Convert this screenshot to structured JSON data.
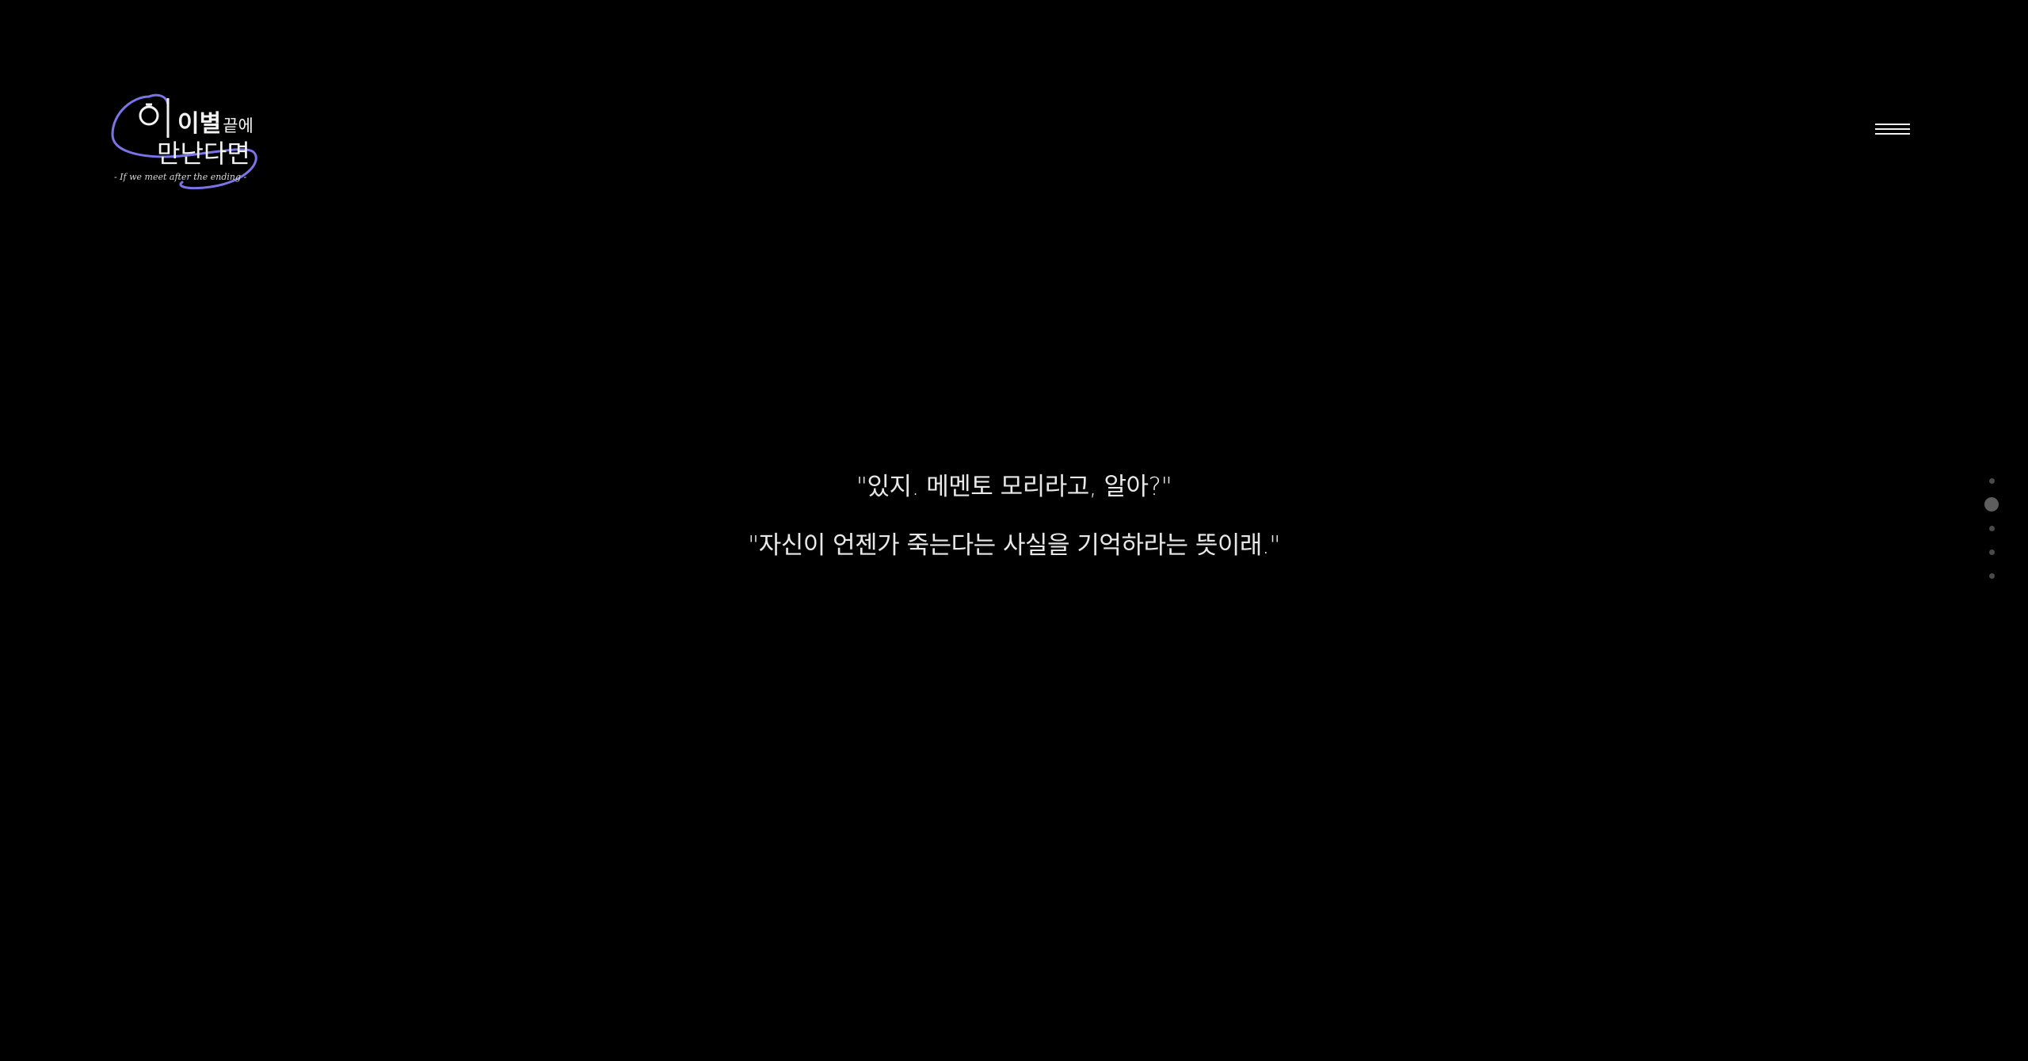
{
  "logo": {
    "title_main": "이별",
    "title_suffix": "끝에",
    "title_second": "만난다면",
    "subtitle": "- If we meet after the ending -",
    "accent_color": "#7b73e8"
  },
  "header": {
    "menu_icon": "hamburger-icon"
  },
  "dialogue": {
    "lines": [
      "\"있지. 메멘토 모리라고, 알아?\"",
      "\"자신이 언젠가 죽는다는 사실을 기억하라는 뜻이래.\""
    ]
  },
  "section_nav": {
    "total": 5,
    "active_index": 1
  },
  "colors": {
    "background": "#000000",
    "text": "#e8e8e8",
    "dot_inactive": "#4a4a4a",
    "dot_active": "#5e5e5e"
  }
}
